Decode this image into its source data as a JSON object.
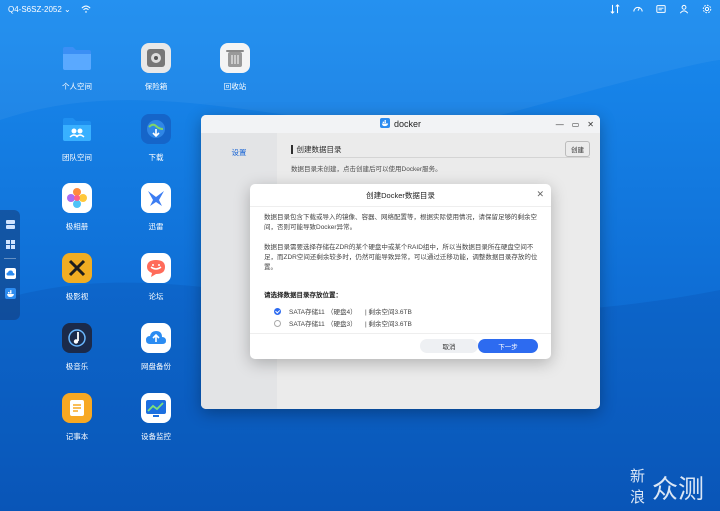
{
  "topbar": {
    "device_name": "Q4-S6SZ-2052",
    "colors": {
      "text": "#ffffff"
    }
  },
  "desktop": {
    "icons": [
      {
        "label": "个人空间",
        "icon": "folder-icon",
        "color": "#4aa3ff"
      },
      {
        "label": "保险箱",
        "icon": "safe-icon",
        "color": "#e0e0e0"
      },
      {
        "label": "回收站",
        "icon": "trash-icon",
        "color": "#f3f3f3"
      },
      {
        "label": "团队空间",
        "icon": "team-folder-icon",
        "color": "#2aa6ff"
      },
      {
        "label": "下载",
        "icon": "download-globe-icon",
        "color": "#1a6fd8"
      },
      {
        "label": "极相册",
        "icon": "photos-icon",
        "color": "#ffffff"
      },
      {
        "label": "迅雷",
        "icon": "thunder-icon",
        "color": "#ffffff"
      },
      {
        "label": "极影视",
        "icon": "video-icon",
        "color": "#f3b023"
      },
      {
        "label": "论坛",
        "icon": "forum-icon",
        "color": "#ffffff"
      },
      {
        "label": "极音乐",
        "icon": "music-icon",
        "color": "#1b2a4a"
      },
      {
        "label": "网盘备份",
        "icon": "cloud-backup-icon",
        "color": "#ffffff"
      },
      {
        "label": "记事本",
        "icon": "notepad-icon",
        "color": "#f7a823"
      },
      {
        "label": "设备监控",
        "icon": "monitor-icon",
        "color": "#ffffff"
      }
    ]
  },
  "window": {
    "title": "docker",
    "sidebar_item": "设置",
    "breadcrumb": "创建数据目录",
    "create_button": "创建",
    "notice": "数据目录未创建，点击创建后可以使用Docker服务。"
  },
  "modal": {
    "title": "创建Docker数据目录",
    "para1": "数据目录包含下载或导入的镜像、容器、网络配置等，根据实际使用情况，请保留足够的剩余空间，否则可能导致Docker异常。",
    "para2": "数据目录需要选择存储在ZDR的某个硬盘中或某个RAID组中，所以当数据目录所在硬盘空间不足，而ZDR空间还剩余较多时，仍然可能导致异常，可以通过迁移功能，调整数据目录存放的位置。",
    "section": "请选择数据目录存放位置：",
    "options": [
      {
        "name": "SATA存储11",
        "disk": "（硬盘4）",
        "space": "| 剩余空间3.6TB",
        "selected": true
      },
      {
        "name": "SATA存储11",
        "disk": "（硬盘3）",
        "space": "| 剩余空间3.6TB",
        "selected": false
      }
    ],
    "cancel": "取消",
    "next": "下一步",
    "colors": {
      "primary": "#2d6bf0"
    }
  }
}
